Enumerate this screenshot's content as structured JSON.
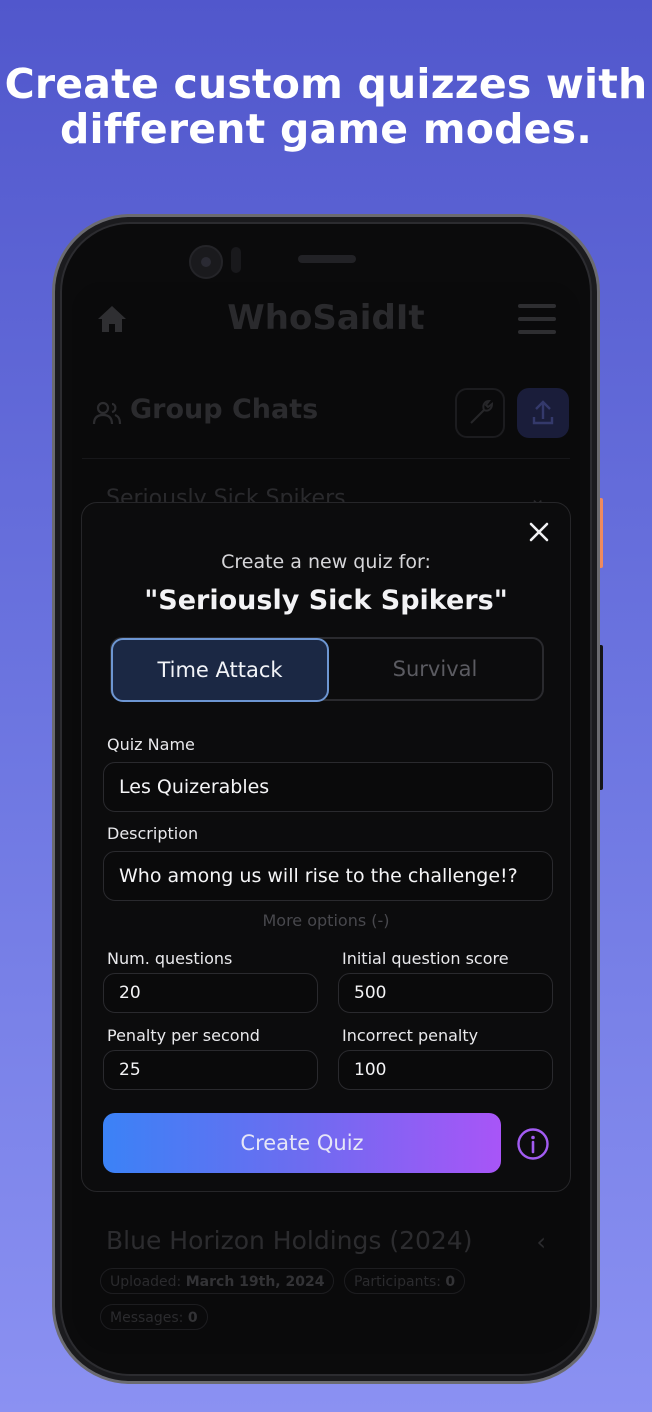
{
  "headline": {
    "line1": "Create custom quizzes with",
    "line2": "different game modes."
  },
  "app": {
    "title": "WhoSaidIt",
    "section_title": "Group Chats",
    "chats": [
      {
        "name": "Seriously Sick Spikers"
      },
      {
        "name": "Blue Horizon Holdings (2024)",
        "uploaded_label": "Uploaded:",
        "uploaded_value": "March 19th, 2024",
        "participants_label": "Participants:",
        "participants_value": "0",
        "messages_label": "Messages:",
        "messages_value": "0"
      }
    ]
  },
  "modal": {
    "subtitle": "Create a new quiz for:",
    "group_name": "\"Seriously Sick Spikers\"",
    "modes": [
      {
        "label": "Time Attack",
        "selected": true
      },
      {
        "label": "Survival",
        "selected": false
      }
    ],
    "quiz_name_label": "Quiz Name",
    "quiz_name_value": "Les Quizerables",
    "description_label": "Description",
    "description_value": "Who among us will rise to the challenge!?",
    "more_options": "More options (-)",
    "num_questions_label": "Num. questions",
    "num_questions_value": "20",
    "initial_score_label": "Initial question score",
    "initial_score_value": "500",
    "penalty_second_label": "Penalty per second",
    "penalty_second_value": "25",
    "incorrect_penalty_label": "Incorrect penalty",
    "incorrect_penalty_value": "100",
    "create_button": "Create Quiz"
  },
  "colors": {
    "accent_blue": "#3b82f6",
    "accent_purple": "#a855f7",
    "selected_tab_border": "#6d96d2",
    "side_button": "#f08a5d"
  }
}
